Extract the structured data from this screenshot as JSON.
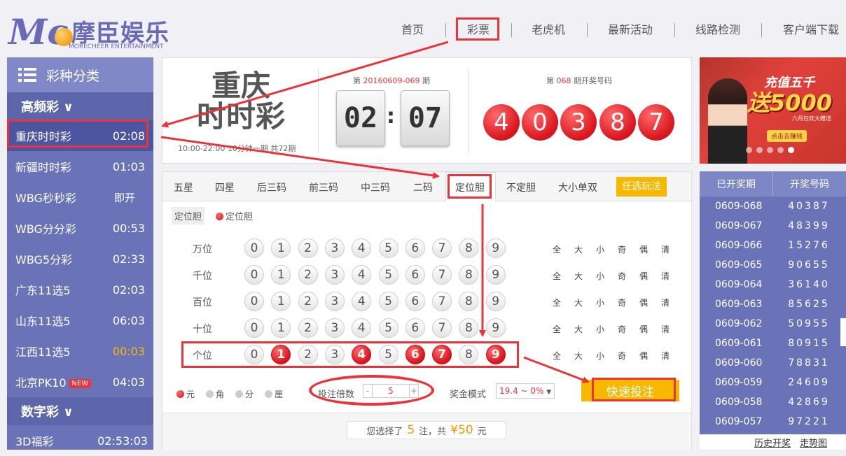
{
  "header": {
    "logo_mark": "Mc",
    "logo_cn": "摩臣娱乐",
    "logo_en": "MORECHEER ENTERTAINMENT",
    "nav": [
      "首页",
      "彩票",
      "老虎机",
      "最新活动",
      "线路检测",
      "客户端下载"
    ]
  },
  "sidebar": {
    "title": "彩种分类",
    "group_high": "高频彩 ∨",
    "items": [
      {
        "name": "重庆时时彩",
        "time": "02:08"
      },
      {
        "name": "新疆时时彩",
        "time": "01:03"
      },
      {
        "name": "WBG秒秒彩",
        "time": "即开"
      },
      {
        "name": "WBG分分彩",
        "time": "00:53"
      },
      {
        "name": "WBG5分彩",
        "time": "02:33"
      },
      {
        "name": "广东11选5",
        "time": "02:03"
      },
      {
        "name": "山东11选5",
        "time": "06:03"
      },
      {
        "name": "江西11选5",
        "time": "00:03"
      },
      {
        "name": "北京PK10",
        "time": "04:03",
        "badge": "NEW"
      }
    ],
    "group_digital": "数字彩 ∨",
    "digital_items": [
      {
        "name": "3D福彩",
        "time": "02:53:03"
      }
    ]
  },
  "game": {
    "name_line1": "重庆",
    "name_line2": "时时彩",
    "hours": "10:00-22:00 10分钟一期 共72期",
    "current_issue_prefix": "第",
    "current_issue": "20160609-069",
    "current_issue_suffix": "期",
    "countdown_min": "02",
    "countdown_sep": ":",
    "countdown_sec": "07",
    "last_issue_prefix": "第",
    "last_issue": "068",
    "last_issue_suffix": "期开奖号码",
    "last_numbers": [
      "4",
      "0",
      "3",
      "8",
      "7"
    ]
  },
  "tabs": [
    "五星",
    "四星",
    "后三码",
    "前三码",
    "中三码",
    "二码",
    "定位胆",
    "不定胆",
    "大小单双",
    "任选玩法"
  ],
  "subtabs": [
    "定位胆",
    "定位胆"
  ],
  "rows": [
    {
      "label": "万位",
      "selected": []
    },
    {
      "label": "千位",
      "selected": []
    },
    {
      "label": "百位",
      "selected": []
    },
    {
      "label": "十位",
      "selected": []
    },
    {
      "label": "个位",
      "selected": [
        1,
        4,
        6,
        7,
        9
      ]
    }
  ],
  "digits": [
    "0",
    "1",
    "2",
    "3",
    "4",
    "5",
    "6",
    "7",
    "8",
    "9"
  ],
  "quick_picks": [
    "全",
    "大",
    "小",
    "奇",
    "偶",
    "清"
  ],
  "units": [
    "元",
    "角",
    "分",
    "厘"
  ],
  "multiplier": {
    "label": "投注倍数",
    "minus": "-",
    "value": "5",
    "plus": "+"
  },
  "bonus": {
    "label": "奖金模式",
    "value": "19.4 ~ 0%",
    "caret": "▼"
  },
  "quick_bet": "快速投注",
  "summary": {
    "prefix": "您选择了",
    "count": "5",
    "mid": "注，共",
    "amount": "¥50",
    "suffix": "元"
  },
  "promo": {
    "line1": "充值五千",
    "line2": "送5000",
    "line3": "六月狂欢大赠送",
    "button": "点击去赚钱"
  },
  "history": {
    "head_period": "已开奖期",
    "head_numbers": "开奖号码",
    "rows": [
      {
        "p": "0609-068",
        "n": "40387"
      },
      {
        "p": "0609-067",
        "n": "48399"
      },
      {
        "p": "0609-066",
        "n": "15276"
      },
      {
        "p": "0609-065",
        "n": "90655"
      },
      {
        "p": "0609-064",
        "n": "36140"
      },
      {
        "p": "0609-063",
        "n": "85625"
      },
      {
        "p": "0609-062",
        "n": "50955"
      },
      {
        "p": "0609-061",
        "n": "80915"
      },
      {
        "p": "0609-060",
        "n": "78831"
      },
      {
        "p": "0609-059",
        "n": "24609"
      },
      {
        "p": "0609-058",
        "n": "42869"
      },
      {
        "p": "0609-057",
        "n": "97221"
      }
    ],
    "link_history": "历史开奖",
    "link_trend": "走势图"
  },
  "colors": {
    "accent_red": "#e8343a",
    "sidebar": "#6a73b8",
    "orange": "#f9b800"
  }
}
